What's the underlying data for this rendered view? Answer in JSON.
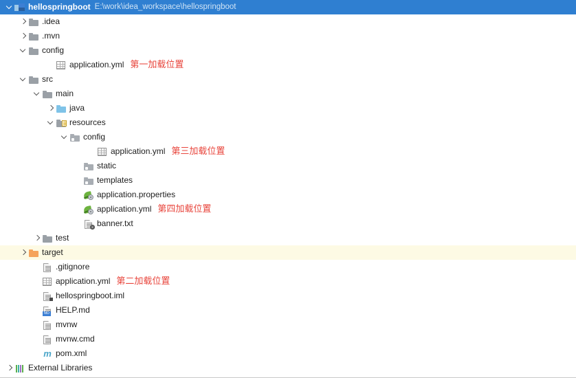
{
  "window": {
    "title": "hellospringboot",
    "path": "E:\\work\\idea_workspace\\hellospringboot",
    "selected_row_color": "#2f7fd1",
    "excluded_row_color": "#fdfae4",
    "annotation_color": "#e8453c"
  },
  "tree": [
    {
      "label": "hellospringboot",
      "path": "E:\\work\\idea_workspace\\hellospringboot",
      "icon": "module-icon",
      "indent": 0,
      "arrow": "down",
      "selected": true,
      "bold": true,
      "note": ""
    },
    {
      "label": ".idea",
      "icon": "folder-grey-icon",
      "indent": 1,
      "arrow": "right",
      "note": ""
    },
    {
      "label": ".mvn",
      "icon": "folder-grey-icon",
      "indent": 1,
      "arrow": "right",
      "note": ""
    },
    {
      "label": "config",
      "icon": "folder-grey-icon",
      "indent": 1,
      "arrow": "down",
      "note": ""
    },
    {
      "label": "application.yml",
      "icon": "yaml-file-icon",
      "indent": 3,
      "arrow": "none",
      "note": "第一加载位置"
    },
    {
      "label": "src",
      "icon": "folder-grey-icon",
      "indent": 1,
      "arrow": "down",
      "note": ""
    },
    {
      "label": "main",
      "icon": "folder-grey-icon",
      "indent": 2,
      "arrow": "down",
      "note": ""
    },
    {
      "label": "java",
      "icon": "folder-source-root-icon",
      "indent": 3,
      "arrow": "right",
      "note": ""
    },
    {
      "label": "resources",
      "icon": "folder-resources-root-icon",
      "indent": 3,
      "arrow": "down",
      "note": ""
    },
    {
      "label": "config",
      "icon": "folder-subdir-icon",
      "indent": 4,
      "arrow": "down",
      "note": ""
    },
    {
      "label": "application.yml",
      "icon": "yaml-file-icon",
      "indent": 6,
      "arrow": "none",
      "note": "第三加载位置"
    },
    {
      "label": "static",
      "icon": "folder-subdir-icon",
      "indent": 5,
      "arrow": "none",
      "note": ""
    },
    {
      "label": "templates",
      "icon": "folder-subdir-icon",
      "indent": 5,
      "arrow": "none",
      "note": ""
    },
    {
      "label": "application.properties",
      "icon": "spring-boot-config-icon",
      "indent": 5,
      "arrow": "none",
      "note": ""
    },
    {
      "label": "application.yml",
      "icon": "spring-boot-config-icon",
      "indent": 5,
      "arrow": "none",
      "note": "第四加载位置"
    },
    {
      "label": "banner.txt",
      "icon": "banner-file-icon",
      "indent": 5,
      "arrow": "none",
      "note": ""
    },
    {
      "label": "test",
      "icon": "folder-grey-icon",
      "indent": 2,
      "arrow": "right",
      "note": ""
    },
    {
      "label": "target",
      "icon": "folder-excluded-icon",
      "indent": 1,
      "arrow": "right",
      "excluded": true,
      "note": ""
    },
    {
      "label": ".gitignore",
      "icon": "text-file-icon",
      "indent": 2,
      "arrow": "none",
      "note": ""
    },
    {
      "label": "application.yml",
      "icon": "yaml-file-icon",
      "indent": 2,
      "arrow": "none",
      "note": "第二加载位置"
    },
    {
      "label": "hellospringboot.iml",
      "icon": "iml-file-icon",
      "indent": 2,
      "arrow": "none",
      "note": ""
    },
    {
      "label": "HELP.md",
      "icon": "markdown-file-icon",
      "indent": 2,
      "arrow": "none",
      "note": ""
    },
    {
      "label": "mvnw",
      "icon": "text-file-icon",
      "indent": 2,
      "arrow": "none",
      "note": ""
    },
    {
      "label": "mvnw.cmd",
      "icon": "text-file-icon",
      "indent": 2,
      "arrow": "none",
      "note": ""
    },
    {
      "label": "pom.xml",
      "icon": "maven-file-icon",
      "indent": 2,
      "arrow": "none",
      "note": ""
    },
    {
      "label": "External Libraries",
      "icon": "external-libraries-icon",
      "indent": 0,
      "arrow": "right",
      "note": ""
    }
  ]
}
